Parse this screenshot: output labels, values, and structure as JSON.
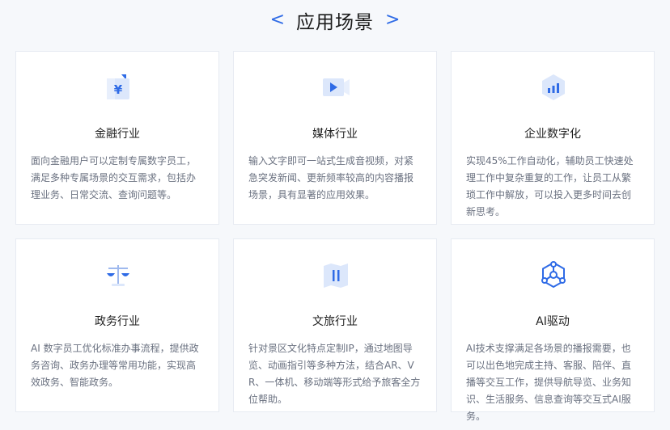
{
  "header": {
    "title": "应用场景",
    "left_arrow": "<",
    "right_arrow": ">"
  },
  "accent_color": "#2f6be6",
  "cards": [
    {
      "title": "金融行业",
      "icon": "finance-icon",
      "desc": "面向金融用户可以定制专属数字员工，满足多种专属场景的交互需求，包括办理业务、日常交流、查询问题等。"
    },
    {
      "title": "媒体行业",
      "icon": "media-video-icon",
      "desc": "输入文字即可一站式生成音视频，对紧急突发新闻、更新频率较高的内容播报场景，具有显著的应用效果。"
    },
    {
      "title": "企业数字化",
      "icon": "digitalization-chart-icon",
      "desc": "实现45%工作自动化，辅助员工快速处理工作中复杂重复的工作，让员工从繁琐工作中解放，可以投入更多时间去创新思考。"
    },
    {
      "title": "政务行业",
      "icon": "government-scale-icon",
      "desc": "AI 数字员工优化标准办事流程，提供政务咨询、政务办理等常用功能，实现高效政务、智能政务。"
    },
    {
      "title": "文旅行业",
      "icon": "tourism-map-icon",
      "desc": "针对景区文化特点定制IP，通过地图导览、动画指引等多种方法，结合AR、VR、一体机、移动端等形式给予旅客全方位帮助。"
    },
    {
      "title": "AI驱动",
      "icon": "ai-network-icon",
      "desc": "AI技术支撑满足各场景的播报需要，也可以出色地完成主持、客服、陪伴、直播等交互工作，提供导航导览、业务知识、生活服务、信息查询等交互式AI服务。"
    }
  ]
}
